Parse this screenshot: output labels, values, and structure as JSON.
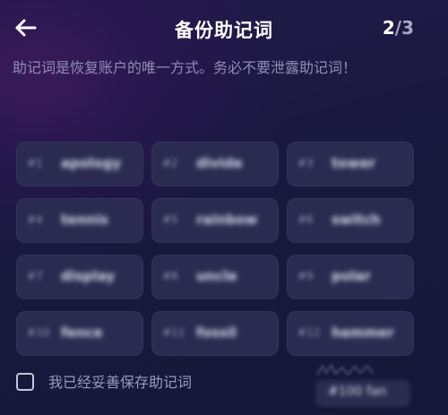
{
  "header": {
    "title": "备份助记词",
    "step_current": "2",
    "step_total": "/3",
    "back_icon": "arrow-left-icon"
  },
  "warning": "助记词是恢复账户的唯一方式。务必不要泄露助记词！",
  "words": [
    {
      "index": "#1",
      "word": "apology"
    },
    {
      "index": "#2",
      "word": "divide"
    },
    {
      "index": "#3",
      "word": "tower"
    },
    {
      "index": "#4",
      "word": "tennis"
    },
    {
      "index": "#5",
      "word": "rainbow"
    },
    {
      "index": "#6",
      "word": "switch"
    },
    {
      "index": "#7",
      "word": "display"
    },
    {
      "index": "#8",
      "word": "uncle"
    },
    {
      "index": "#9",
      "word": "polar"
    },
    {
      "index": "#10",
      "word": "fence"
    },
    {
      "index": "#11",
      "word": "fossil"
    },
    {
      "index": "#12",
      "word": "hammer"
    }
  ],
  "confirm": {
    "label": "我已经妥善保存助记词",
    "checked": false
  },
  "floating_tag": "#100 fan"
}
